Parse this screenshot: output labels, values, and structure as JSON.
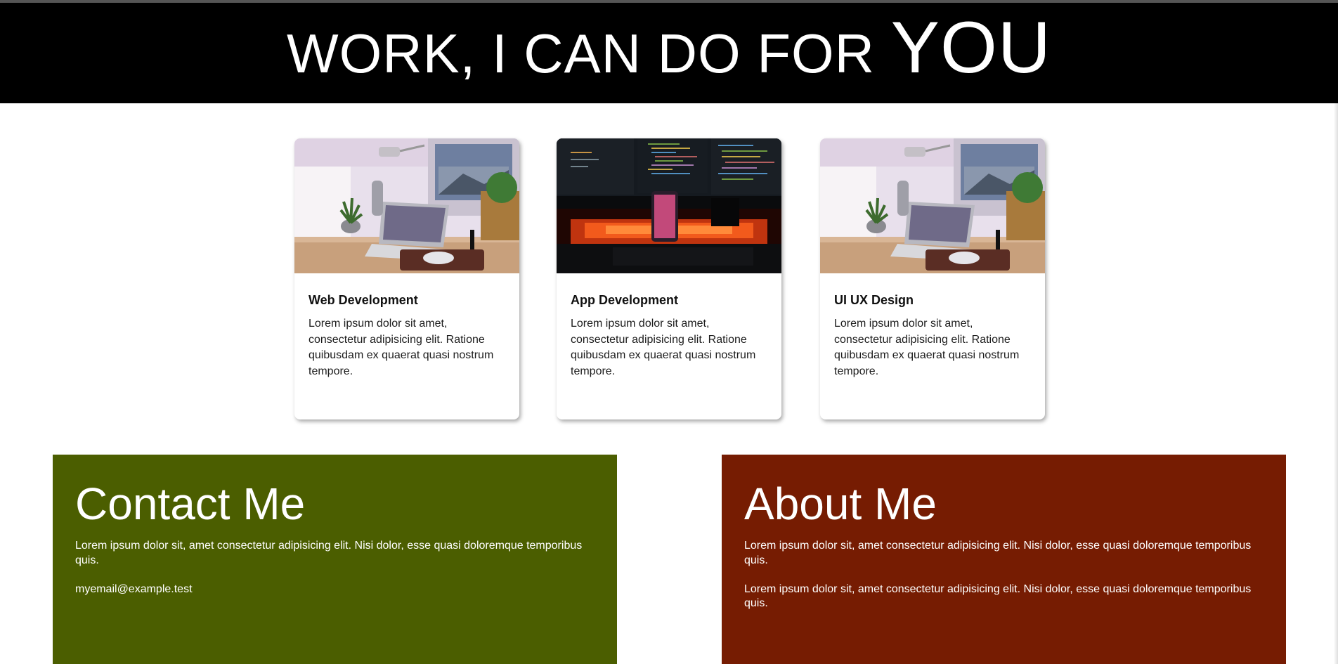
{
  "colors": {
    "hero_bg": "#000000",
    "contact_bg": "#4b5e00",
    "about_bg": "#761c02",
    "card_bg": "#ffffff"
  },
  "hero": {
    "title_main": "WORK, I CAN DO FOR ",
    "title_emphasis": "YOU"
  },
  "cards": [
    {
      "title": "Web Development",
      "text": "Lorem ipsum dolor sit amet, consectetur adipisicing elit. Ratione quibusdam ex quaerat quasi nostrum tempore.",
      "image_icon": "laptop-desk-photo"
    },
    {
      "title": "App Development",
      "text": "Lorem ipsum dolor sit amet, consectetur adipisicing elit. Ratione quibusdam ex quaerat quasi nostrum tempore.",
      "image_icon": "code-monitor-photo"
    },
    {
      "title": "UI UX Design",
      "text": "Lorem ipsum dolor sit amet, consectetur adipisicing elit. Ratione quibusdam ex quaerat quasi nostrum tempore.",
      "image_icon": "laptop-desk-photo"
    }
  ],
  "contact": {
    "heading": "Contact Me",
    "text": "Lorem ipsum dolor sit, amet consectetur adipisicing elit. Nisi dolor, esse quasi doloremque temporibus quis.",
    "email": "myemail@example.test"
  },
  "about": {
    "heading": "About Me",
    "paragraphs": [
      "Lorem ipsum dolor sit, amet consectetur adipisicing elit. Nisi dolor, esse quasi doloremque temporibus quis.",
      "Lorem ipsum dolor sit, amet consectetur adipisicing elit. Nisi dolor, esse quasi doloremque temporibus quis."
    ]
  }
}
